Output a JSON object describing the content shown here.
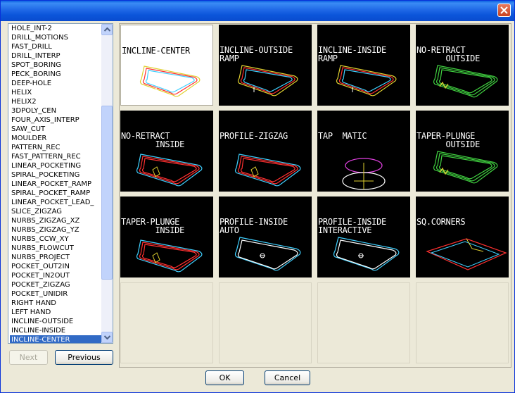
{
  "listbox": {
    "items": [
      "HOLE_INT-2",
      "DRILL_MOTIONS",
      "FAST_DRILL",
      "DRILL_INTERP",
      "SPOT_BORING",
      "PECK_BORING",
      "DEEP-HOLE",
      "HELIX",
      "HELIX2",
      "3DPOLY_CEN",
      "FOUR_AXIS_INTERP",
      "SAW_CUT",
      "MOULDER",
      "PATTERN_REC",
      "FAST_PATTERN_REC",
      "LINEAR_POCKETING",
      "SPIRAL_POCKETING",
      "LINEAR_POCKET_RAMP",
      "SPIRAL_POCKET_RAMP",
      "LINEAR_POCKET_LEAD_",
      "SLICE_ZIGZAG",
      "NURBS_ZIGZAG_XZ",
      "NURBS_ZIGZAG_YZ",
      "NURBS_CCW_XY",
      "NURBS_FLOWCUT",
      "NURBS_PROJECT",
      "POCKET_OUT2IN",
      "POCKET_IN2OUT",
      "POCKET_ZIGZAG",
      "POCKET_UNIDIR",
      "RIGHT HAND",
      "LEFT HAND",
      "INCLINE-OUTSIDE",
      "INCLINE-INSIDE",
      "INCLINE-CENTER"
    ],
    "selected": "INCLINE-CENTER"
  },
  "buttons": {
    "next": "Next",
    "previous": "Previous",
    "ok": "OK",
    "cancel": "Cancel"
  },
  "thumbnails": [
    {
      "label": "INCLINE-CENTER",
      "style": "white",
      "icon": "incline-pocket"
    },
    {
      "label": "INCLINE-OUTSIDE\nRAMP",
      "icon": "incline-pocket"
    },
    {
      "label": "INCLINE-INSIDE\nRAMP",
      "icon": "incline-pocket"
    },
    {
      "label": "NO-RETRACT\n      OUTSIDE",
      "icon": "green-pocket"
    },
    {
      "label": "NO-RETRACT\n       INSIDE",
      "icon": "red-pocket"
    },
    {
      "label": "PROFILE-ZIGZAG",
      "icon": "red-pocket"
    },
    {
      "label": "TAP  MATIC",
      "icon": "tap-circle"
    },
    {
      "label": "TAPER-PLUNGE\n      OUTSIDE",
      "icon": "green-pocket"
    },
    {
      "label": "TAPER-PLUNGE\n       INSIDE",
      "icon": "red-pocket"
    },
    {
      "label": "PROFILE-INSIDE\nAUTO",
      "icon": "profile-pocket"
    },
    {
      "label": "PROFILE-INSIDE\nINTERACTIVE",
      "icon": "profile-pocket"
    },
    {
      "label": "SQ.CORNERS",
      "icon": "sq-corners"
    },
    {
      "label": "",
      "style": "empty"
    },
    {
      "label": "",
      "style": "empty"
    },
    {
      "label": "",
      "style": "empty"
    },
    {
      "label": "",
      "style": "empty"
    }
  ],
  "colors": {
    "titlebar": "#0a58dc",
    "selection": "#316ac5",
    "close": "#d84a27"
  }
}
